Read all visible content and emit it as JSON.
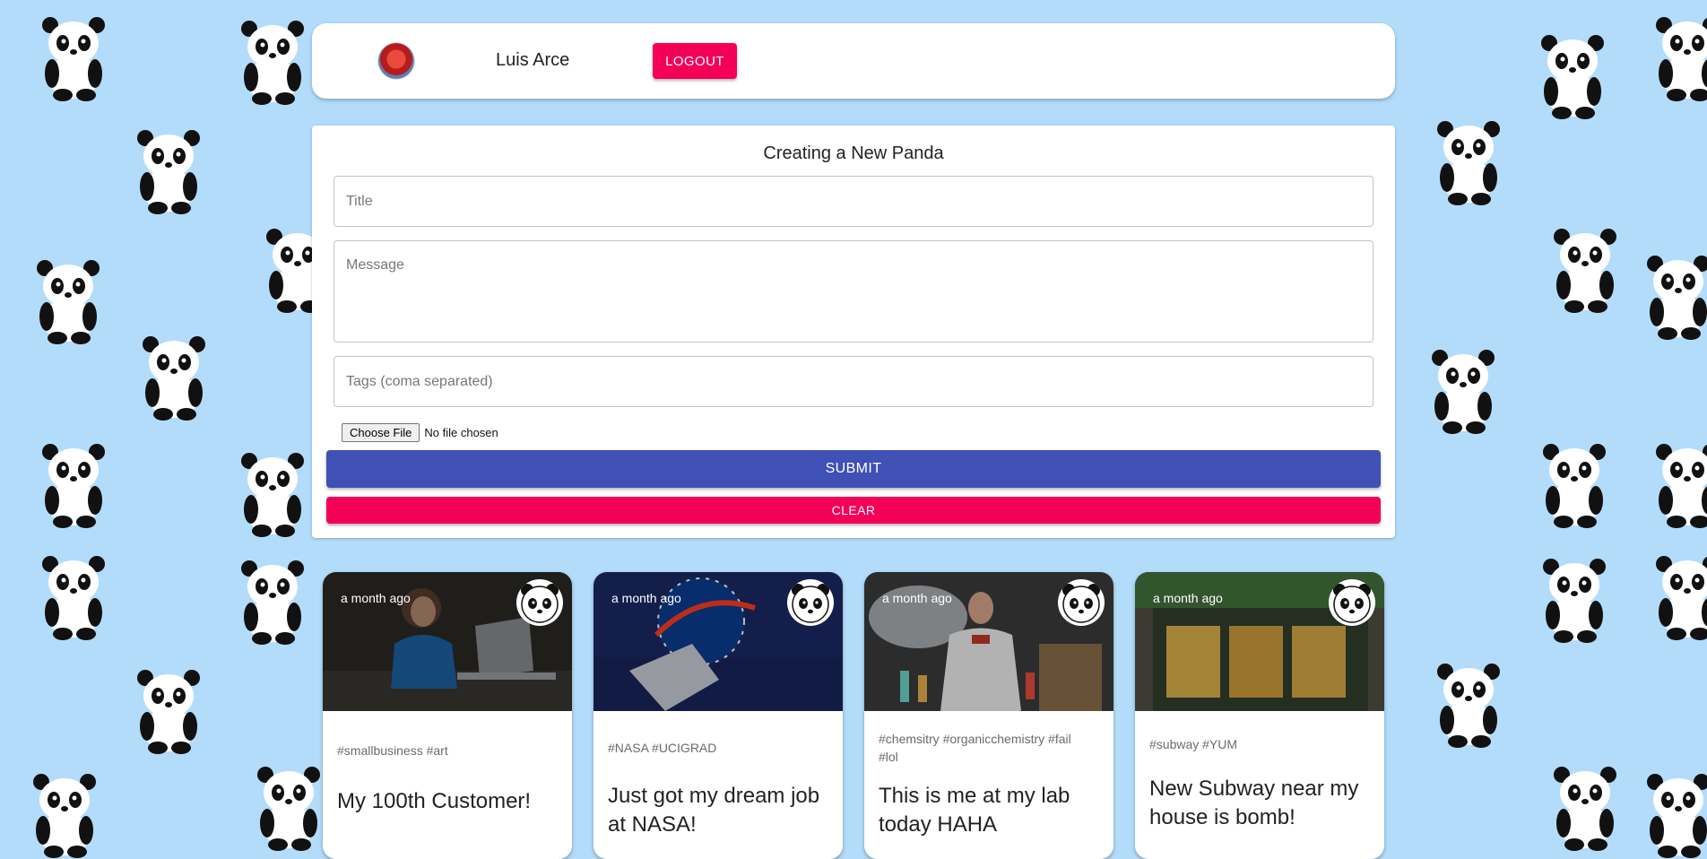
{
  "header": {
    "username": "Luis Arce",
    "logout_label": "LOGOUT"
  },
  "form": {
    "heading": "Creating a New Panda",
    "title_placeholder": "Title",
    "message_placeholder": "Message",
    "tags_placeholder": "Tags (coma separated)",
    "choose_file_label": "Choose File",
    "file_status": "No file chosen",
    "submit_label": "SUBMIT",
    "clear_label": "CLEAR"
  },
  "posts": [
    {
      "time": "a month ago",
      "tags": "#smallbusiness #art",
      "title": "My 100th Customer!",
      "image": "woman-laptop"
    },
    {
      "time": "a month ago",
      "tags": "#NASA #UCIGRAD",
      "title": "Just got my dream job at NASA!",
      "image": "nasa-logo"
    },
    {
      "time": "a month ago",
      "tags": "#chemsitry #organicchemistry #fail #lol",
      "title": "This is me at my lab today HAHA",
      "image": "scientist-lab"
    },
    {
      "time": "a month ago",
      "tags": "#subway #YUM",
      "title": "New Subway near my house is bomb!",
      "image": "subway-store"
    }
  ],
  "icons": {
    "post_badge": "panda-icon",
    "background": "panda-pattern"
  },
  "colors": {
    "background": "#b3dcfb",
    "primary": "#3f51b5",
    "secondary": "#f50057"
  }
}
